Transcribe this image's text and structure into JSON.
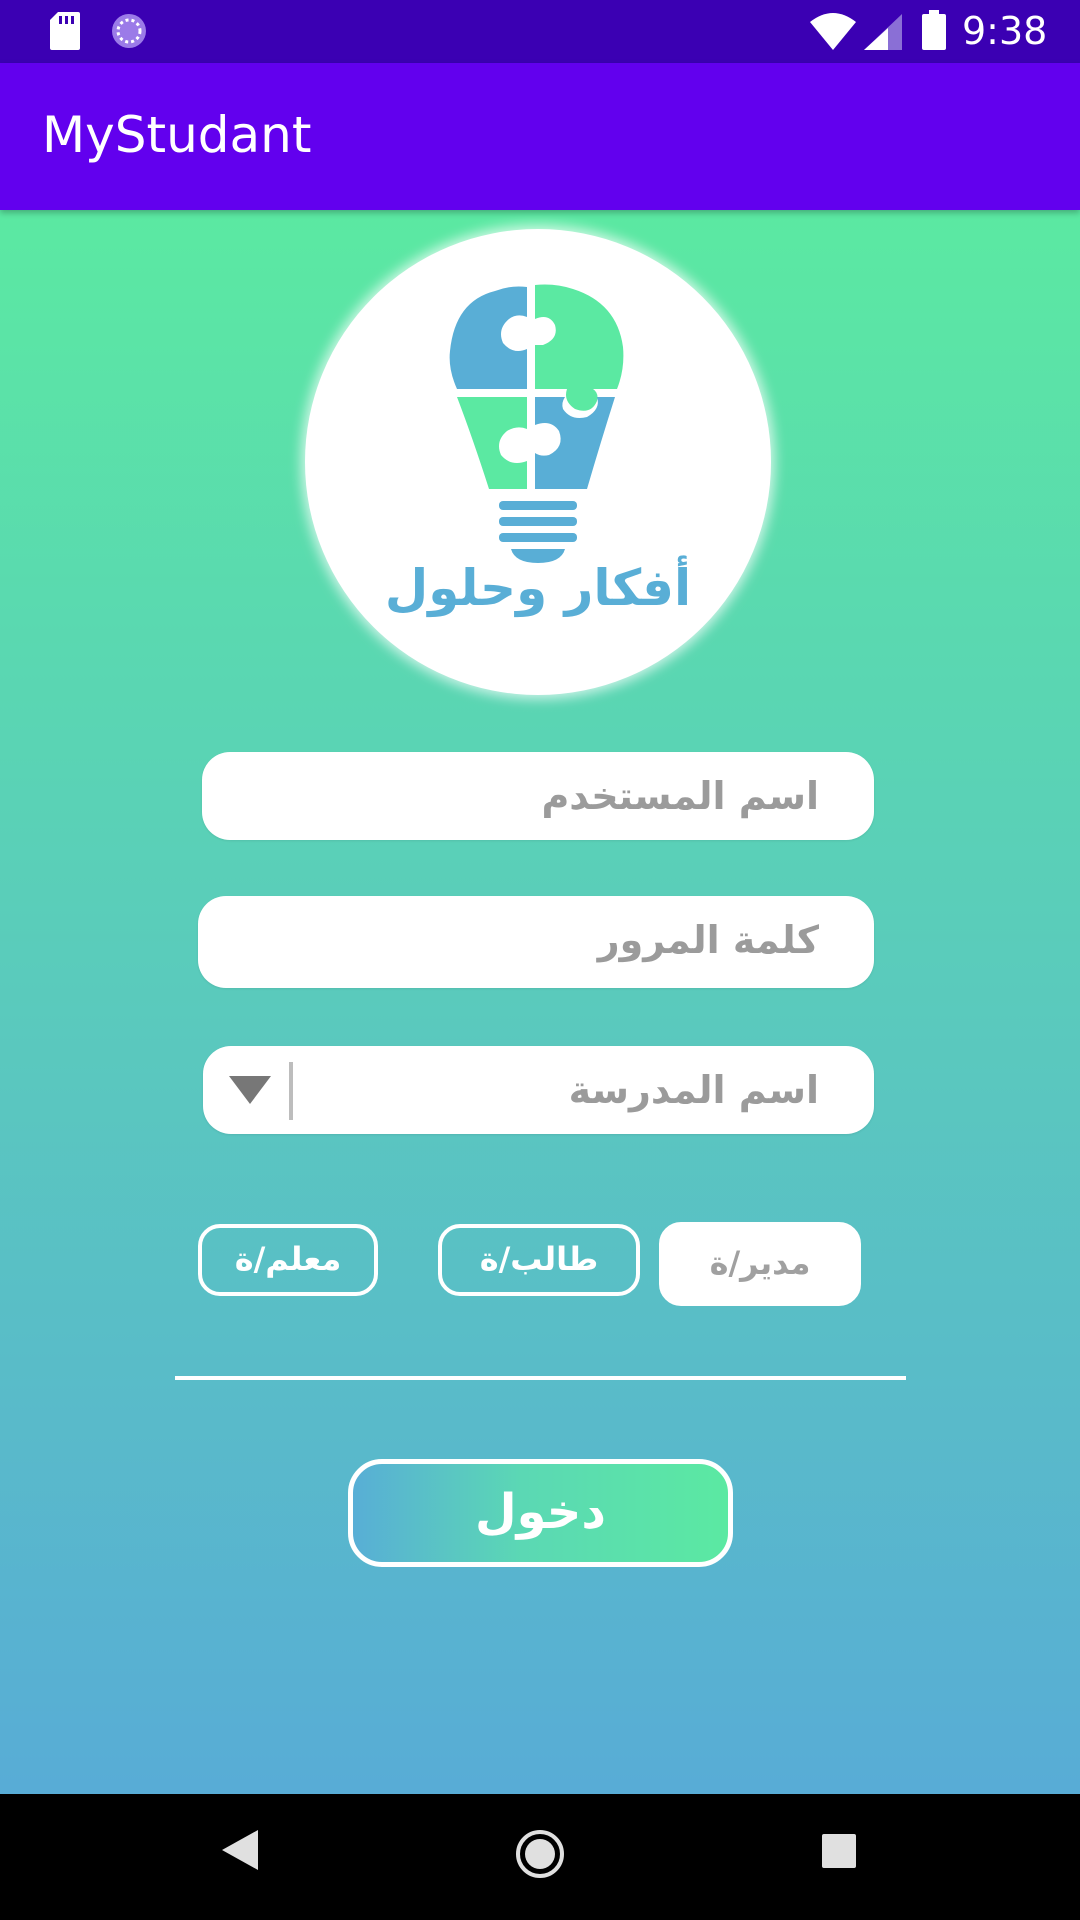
{
  "status_bar": {
    "time": "9:38",
    "icons": [
      "sd-card-icon",
      "sync-icon",
      "wifi-icon",
      "signal-icon",
      "battery-icon"
    ]
  },
  "app_bar": {
    "title": "MyStudant"
  },
  "logo": {
    "text": "أفكار وحلول",
    "icon": "lightbulb-puzzle-icon"
  },
  "form": {
    "username_placeholder": "اسم المستخدم",
    "password_placeholder": "كلمة المرور",
    "school_placeholder": "اسم المدرسة"
  },
  "roles": {
    "teacher": "معلم/ة",
    "student": "طالب/ة",
    "manager": "مدير/ة",
    "selected": "manager"
  },
  "login_button": {
    "label": "دخول"
  },
  "nav_bar": {
    "icons": [
      "back-icon",
      "home-icon",
      "recents-icon"
    ]
  },
  "colors": {
    "status_bar": "#3b00b3",
    "app_bar": "#6200ee",
    "gradient_top": "#5be9a2",
    "gradient_bottom": "#58acd6",
    "logo_blue": "#59aed6",
    "logo_green": "#5be9a2"
  }
}
